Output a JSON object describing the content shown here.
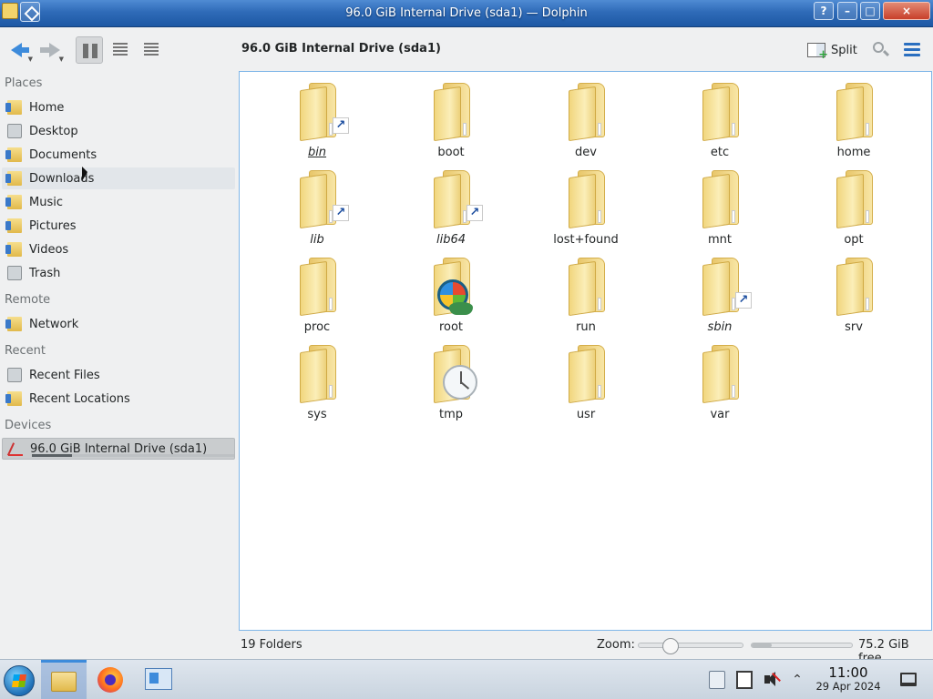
{
  "window": {
    "title": "96.0 GiB Internal Drive (sda1) — Dolphin",
    "help_label": "?",
    "min_label": "–",
    "max_label": "□",
    "close_label": "×"
  },
  "toolbar": {
    "location_title": "96.0 GiB Internal Drive (sda1)",
    "split_label": "Split",
    "back_icon": "back-arrow-icon",
    "forward_icon": "forward-arrow-icon",
    "view_modes": [
      "icons",
      "compact",
      "details"
    ],
    "active_view_mode": "icons"
  },
  "sidebar": {
    "sections": [
      {
        "label": "Places",
        "items": [
          {
            "label": "Home",
            "icon": "home-folder-icon"
          },
          {
            "label": "Desktop",
            "icon": "desktop-icon"
          },
          {
            "label": "Documents",
            "icon": "documents-folder-icon"
          },
          {
            "label": "Downloads",
            "icon": "downloads-folder-icon"
          },
          {
            "label": "Music",
            "icon": "music-folder-icon"
          },
          {
            "label": "Pictures",
            "icon": "pictures-folder-icon"
          },
          {
            "label": "Videos",
            "icon": "videos-folder-icon"
          },
          {
            "label": "Trash",
            "icon": "trash-icon"
          }
        ]
      },
      {
        "label": "Remote",
        "items": [
          {
            "label": "Network",
            "icon": "network-folder-icon"
          }
        ]
      },
      {
        "label": "Recent",
        "items": [
          {
            "label": "Recent Files",
            "icon": "recent-files-icon"
          },
          {
            "label": "Recent Locations",
            "icon": "recent-locations-icon"
          }
        ]
      },
      {
        "label": "Devices",
        "items": [
          {
            "label": "96.0 GiB Internal Drive (sda1)",
            "icon": "drive-icon",
            "selected": true,
            "usage_fraction": 0.2
          }
        ]
      }
    ]
  },
  "folders": [
    {
      "name": "bin",
      "symlink": true,
      "emblem": "link"
    },
    {
      "name": "boot",
      "symlink": false
    },
    {
      "name": "dev",
      "symlink": false
    },
    {
      "name": "etc",
      "symlink": false
    },
    {
      "name": "home",
      "symlink": false
    },
    {
      "name": "lib",
      "symlink": true,
      "emblem": "link"
    },
    {
      "name": "lib64",
      "symlink": true,
      "emblem": "link"
    },
    {
      "name": "lost+found",
      "symlink": false
    },
    {
      "name": "mnt",
      "symlink": false
    },
    {
      "name": "opt",
      "symlink": false
    },
    {
      "name": "proc",
      "symlink": false
    },
    {
      "name": "root",
      "symlink": false,
      "emblem": "root"
    },
    {
      "name": "run",
      "symlink": false
    },
    {
      "name": "sbin",
      "symlink": true,
      "emblem": "link"
    },
    {
      "name": "srv",
      "symlink": false
    },
    {
      "name": "sys",
      "symlink": false
    },
    {
      "name": "tmp",
      "symlink": false,
      "emblem": "clock"
    },
    {
      "name": "usr",
      "symlink": false
    },
    {
      "name": "var",
      "symlink": false
    }
  ],
  "statusbar": {
    "summary": "19 Folders",
    "zoom_label": "Zoom:",
    "zoom_level_fraction": 0.3,
    "free_space": "75.2 GiB free",
    "used_fraction": 0.2
  },
  "taskbar": {
    "tasks": [
      "file-manager-icon",
      "firefox-icon",
      "settings-icon"
    ],
    "active_task": "file-manager-icon",
    "clock_time": "11:00",
    "clock_date": "29 Apr 2024"
  }
}
